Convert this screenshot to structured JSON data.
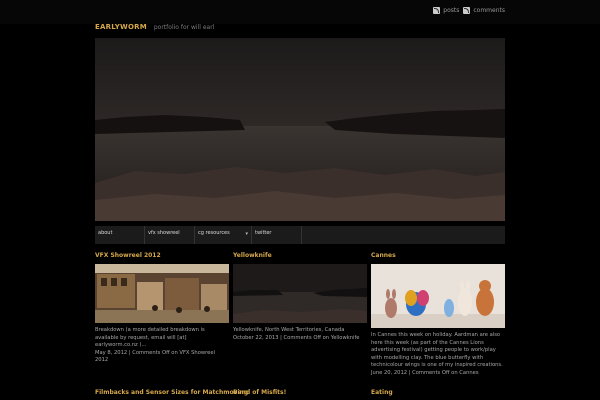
{
  "header": {
    "feeds": [
      {
        "icon": "rss-icon",
        "label": "posts"
      },
      {
        "icon": "rss-icon",
        "label": "comments"
      }
    ],
    "site_name": "EARLYWORM",
    "tagline": "portfolio for will earl"
  },
  "nav": {
    "items": [
      {
        "label": "about"
      },
      {
        "label": "vfx showreel"
      },
      {
        "label": "cg resources",
        "dropdown": true
      },
      {
        "label": "twitter"
      }
    ],
    "caret_icon": "chevron-down-icon"
  },
  "posts": [
    {
      "title": "VFX Showreel 2012",
      "excerpt": "Breakdown (a more detailed breakdown is available by request, email will [at] earlyworm.co.nz )...",
      "meta": "May 8, 2012 | Comments Off on VFX Showreel 2012"
    },
    {
      "title": "Yellowknife",
      "excerpt": "Yellowknife, North West Territories, Canada",
      "meta": "October 22, 2013 | Comments Off on Yellowknife"
    },
    {
      "title": "Cannes",
      "excerpt": "In Cannes this week on holiday. Aardman are also here this week (as part of the Cannes Lions advertising festival) getting people to work/play with modelling clay. The blue butterfly with technicolour wings is one of my inspired creations.",
      "meta": "June 20, 2012 | Comments Off on Cannes"
    }
  ],
  "more_posts": [
    {
      "title": "Filmbacks and Sensor Sizes for Matchmoving"
    },
    {
      "title": "Band of Misfits!"
    },
    {
      "title": "Eating"
    }
  ]
}
